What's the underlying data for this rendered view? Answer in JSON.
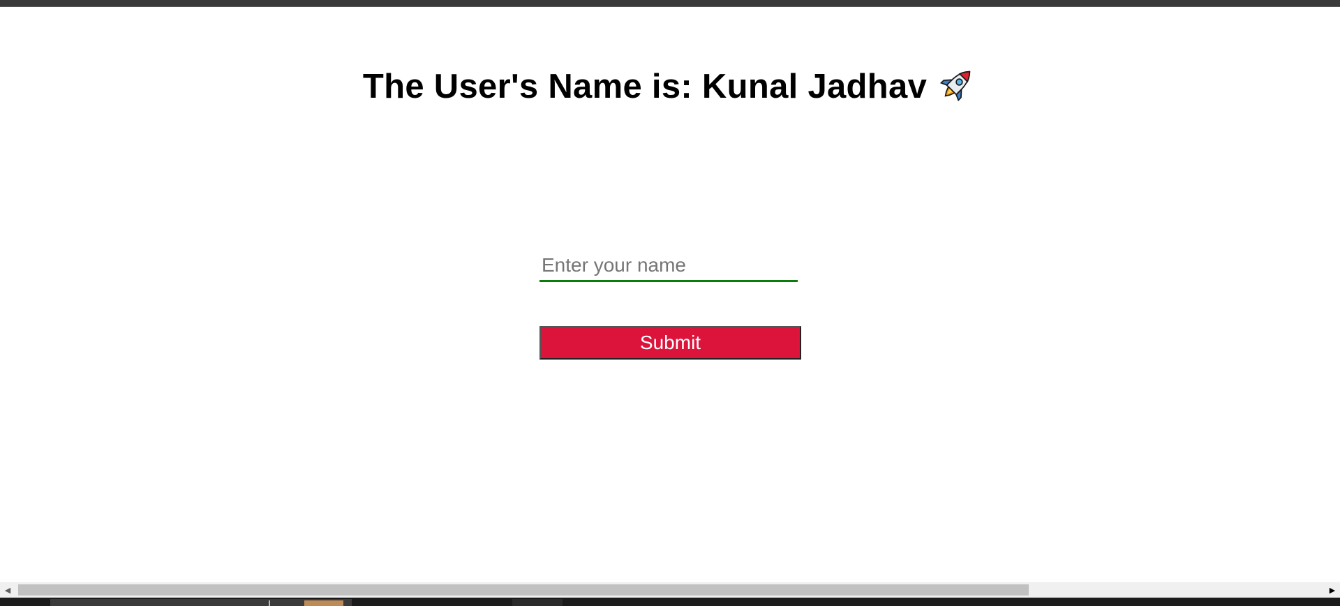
{
  "page": {
    "heading": "The User's Name is: Kunal Jadhav",
    "heading_emoji_icon": "rocket-icon"
  },
  "form": {
    "name_input": {
      "value": "",
      "placeholder": "Enter your name"
    },
    "submit_label": "Submit"
  },
  "colors": {
    "submit_background": "#dc143c",
    "submit_text": "#ffffff",
    "input_underline": "#0a7d0a",
    "page_background": "#ffffff"
  },
  "scrollbar": {
    "left_arrow_icon": "scroll-left-arrow-icon",
    "right_arrow_icon": "scroll-right-arrow-icon"
  }
}
